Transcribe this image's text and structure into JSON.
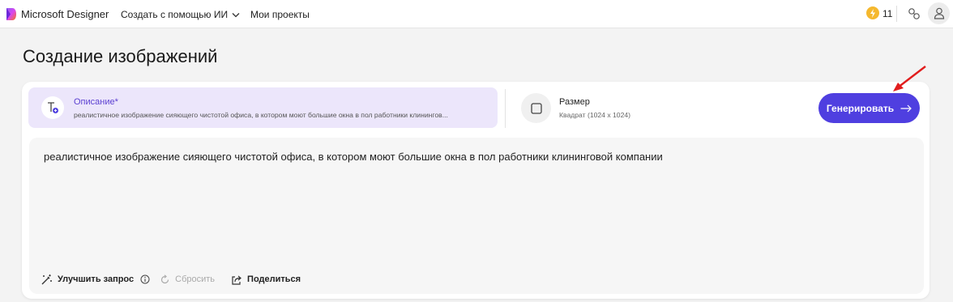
{
  "header": {
    "app_name": "Microsoft Designer",
    "nav_create": "Создать с помощью ИИ",
    "nav_projects": "Мои проекты",
    "credits": "11",
    "coin_icon": "lightning-icon",
    "brand_color": "#4f3fe0"
  },
  "page": {
    "title": "Создание изображений"
  },
  "description_tab": {
    "label": "Описание*",
    "summary": "реалистичное изображение сияющего чистотой офиса, в котором моют большие окна в пол работники клинингов..."
  },
  "size_tab": {
    "label": "Размер",
    "value": "Квадрат (1024 x 1024)"
  },
  "generate_button": {
    "label": "Генерировать"
  },
  "prompt": {
    "text": "реалистичное изображение сияющего чистотой офиса, в котором моют большие окна в пол работники клининговой компании"
  },
  "actions": {
    "improve": "Улучшить запрос",
    "reset": "Сбросить",
    "share": "Поделиться"
  }
}
